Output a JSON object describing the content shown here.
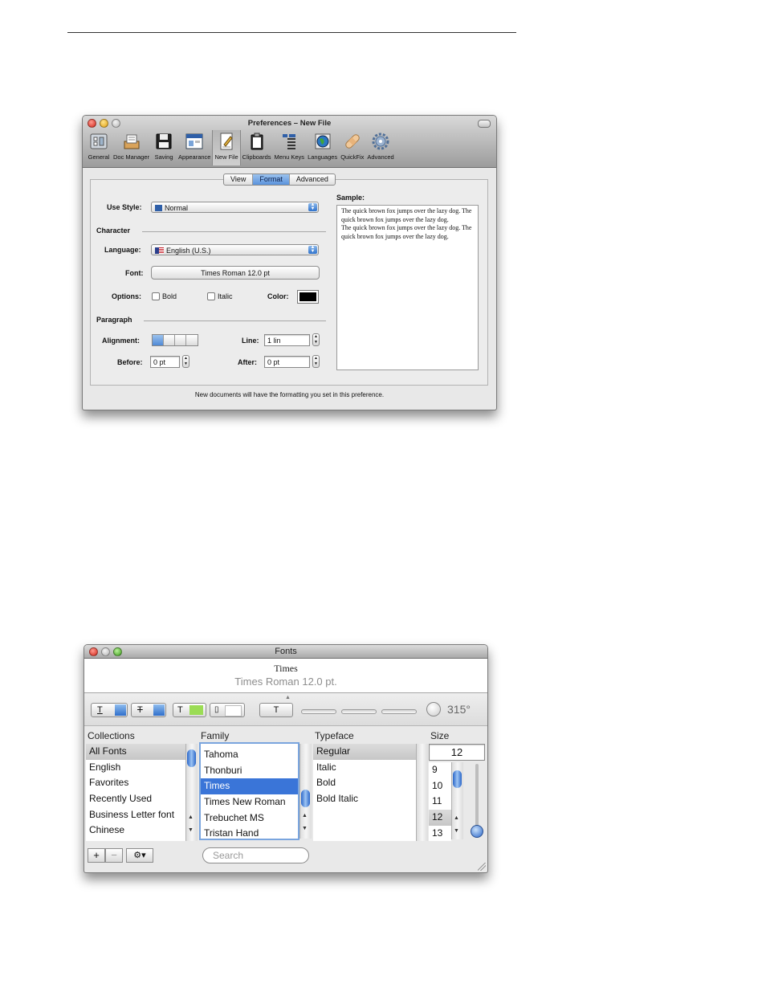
{
  "prefs_window": {
    "title": "Preferences – New File",
    "toolbar": [
      {
        "label": "General",
        "icon": "general-icon"
      },
      {
        "label": "Doc Manager",
        "icon": "doc-manager-icon"
      },
      {
        "label": "Saving",
        "icon": "floppy-disk-icon"
      },
      {
        "label": "Appearance",
        "icon": "appearance-icon"
      },
      {
        "label": "New File",
        "icon": "new-file-icon",
        "selected": true
      },
      {
        "label": "Clipboards",
        "icon": "clipboard-icon"
      },
      {
        "label": "Menu Keys",
        "icon": "menu-keys-icon"
      },
      {
        "label": "Languages",
        "icon": "globe-icon"
      },
      {
        "label": "QuickFix",
        "icon": "bandage-icon"
      },
      {
        "label": "Advanced",
        "icon": "gear-icon"
      }
    ],
    "tabs": [
      {
        "label": "View"
      },
      {
        "label": "Format",
        "active": true
      },
      {
        "label": "Advanced"
      }
    ],
    "use_style_label": "Use Style:",
    "use_style_value": "Normal",
    "character_header": "Character",
    "language_label": "Language:",
    "language_value": "English (U.S.)",
    "font_label": "Font:",
    "font_value": "Times Roman 12.0 pt",
    "options_label": "Options:",
    "bold_label": "Bold",
    "italic_label": "Italic",
    "color_label": "Color:",
    "color_value": "#000000",
    "paragraph_header": "Paragraph",
    "alignment_label": "Alignment:",
    "line_label": "Line:",
    "line_value": "1 lin",
    "before_label": "Before:",
    "before_value": "0 pt",
    "after_label": "After:",
    "after_value": "0 pt",
    "sample_label": "Sample:",
    "sample_text": "The quick brown fox jumps over the lazy dog. The quick brown fox jumps over the lazy dog.\nThe quick brown fox jumps over the lazy dog. The quick brown fox jumps over the lazy dog.",
    "footnote": "New documents will have the formatting you set in this preference."
  },
  "fonts_window": {
    "title": "Fonts",
    "preview_name": "Times",
    "preview_desc": "Times Roman 12.0 pt.",
    "rotation": "315°",
    "headers": {
      "collections": "Collections",
      "family": "Family",
      "typeface": "Typeface",
      "size": "Size"
    },
    "collections": [
      "All Fonts",
      "English",
      "Favorites",
      "Recently Used",
      "Business Letter font",
      "Chinese"
    ],
    "families": [
      "Tahoma",
      "Thonburi",
      "Times",
      "Times New Roman",
      "Trebuchet MS",
      "Tristan Hand"
    ],
    "typefaces": [
      "Regular",
      "Italic",
      "Bold",
      "Bold Italic"
    ],
    "size_value": "12",
    "sizes": [
      "9",
      "10",
      "11",
      "12",
      "13"
    ],
    "add_label": "+",
    "remove_label": "−",
    "search_placeholder": "Search"
  }
}
